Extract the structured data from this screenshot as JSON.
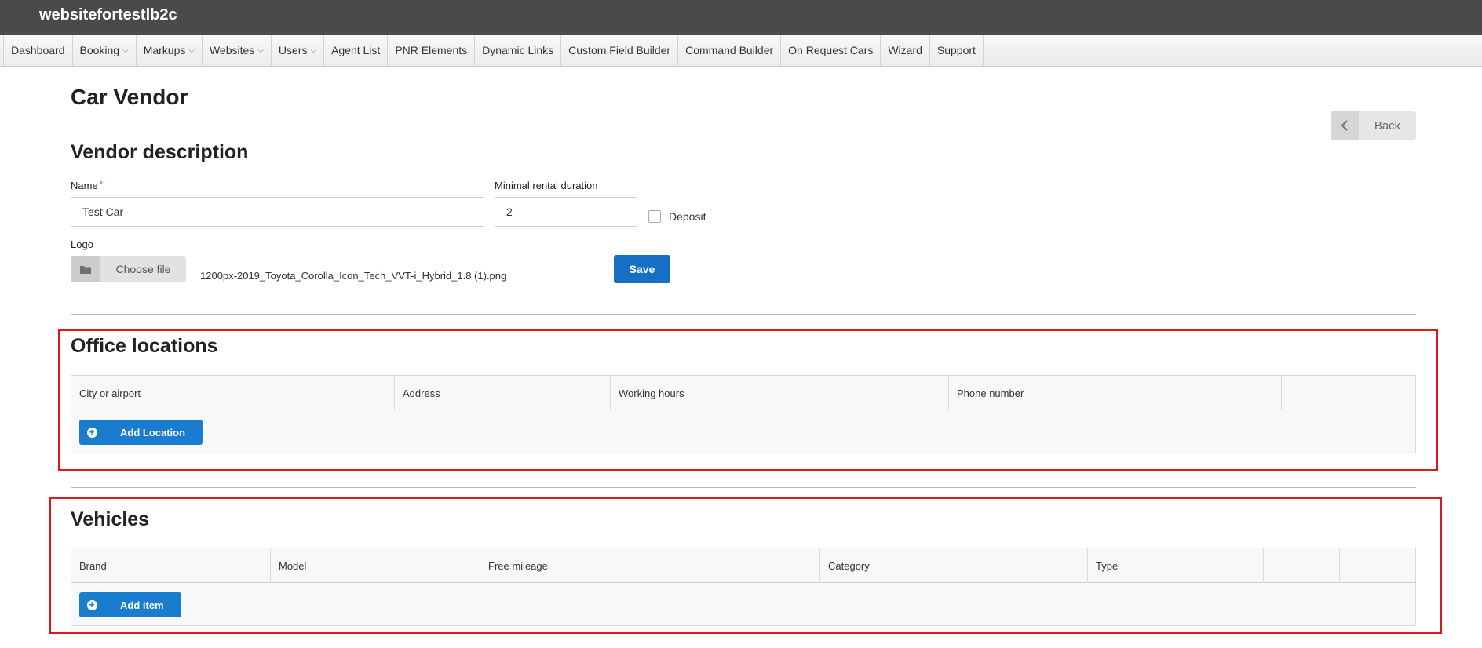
{
  "site": {
    "title": "websitefortestlb2c"
  },
  "nav": {
    "items": [
      {
        "label": "Dashboard",
        "caret": ""
      },
      {
        "label": "Booking",
        "caret": "⌄"
      },
      {
        "label": "Markups",
        "caret": "⌄"
      },
      {
        "label": "Websites",
        "caret": "⌄"
      },
      {
        "label": "Users",
        "caret": "⌄"
      },
      {
        "label": "Agent List",
        "caret": ""
      },
      {
        "label": "PNR Elements",
        "caret": ""
      },
      {
        "label": "Dynamic Links",
        "caret": ""
      },
      {
        "label": "Custom Field Builder",
        "caret": ""
      },
      {
        "label": "Command Builder",
        "caret": ""
      },
      {
        "label": "On Request Cars",
        "caret": ""
      },
      {
        "label": "Wizard",
        "caret": ""
      },
      {
        "label": "Support",
        "caret": ""
      }
    ]
  },
  "page": {
    "title": "Car Vendor",
    "back_label": "Back",
    "back_icon": "chevron-left-icon"
  },
  "vendor": {
    "section_title": "Vendor description",
    "name_label": "Name",
    "name_required_mark": "*",
    "name_value": "Test Car",
    "min_rental_label": "Minimal rental duration",
    "min_rental_value": "2",
    "deposit_label": "Deposit",
    "deposit_checked": false,
    "logo_label": "Logo",
    "choose_file_label": "Choose file",
    "folder_icon": "folder-icon",
    "file_name": "1200px-2019_Toyota_Corolla_Icon_Tech_VVT-i_Hybrid_1.8 (1).png",
    "save_label": "Save"
  },
  "office_locations": {
    "section_title": "Office locations",
    "columns": [
      "City or airport",
      "Address",
      "Working hours",
      "Phone number",
      "",
      ""
    ],
    "add_label": "Add Location",
    "add_icon": "plus-circle-icon"
  },
  "vehicles": {
    "section_title": "Vehicles",
    "columns": [
      "Brand",
      "Model",
      "Free mileage",
      "Category",
      "Type",
      "",
      ""
    ],
    "add_label": "Add item",
    "add_icon": "plus-circle-icon"
  },
  "colors": {
    "primary": "#1570c5",
    "highlight_border": "#e0161b",
    "topbar": "#4a4a4a"
  }
}
